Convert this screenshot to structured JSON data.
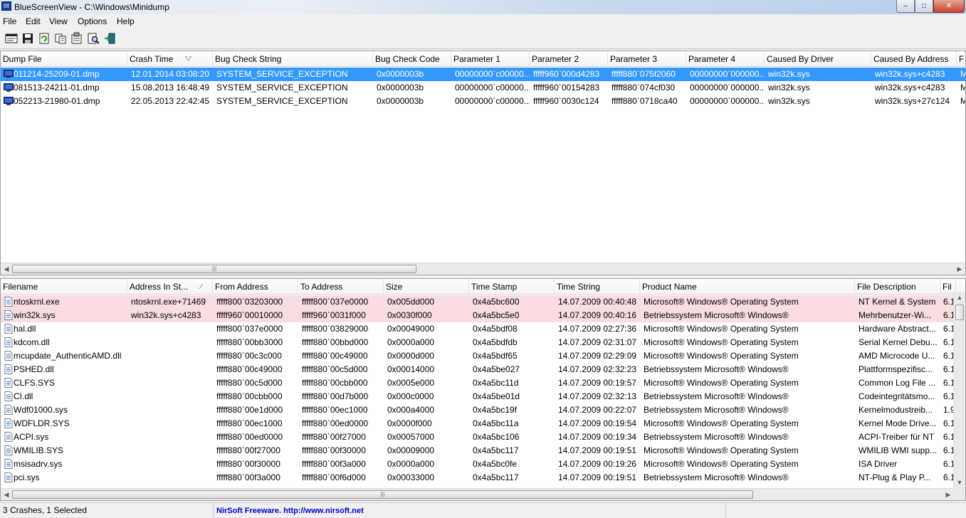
{
  "window": {
    "title": "BlueScreenView  -  C:\\Windows\\Minidump",
    "min_symbol": "–",
    "max_symbol": "□",
    "close_symbol": "✕"
  },
  "menu": [
    "File",
    "Edit",
    "View",
    "Options",
    "Help"
  ],
  "toolbar": [
    "html-report-icon",
    "save-icon",
    "refresh-icon",
    "copy-icon",
    "properties-icon",
    "find-icon",
    "exit-icon"
  ],
  "dumps": {
    "columns": [
      "Dump File",
      "Crash Time",
      "Bug Check String",
      "Bug Check Code",
      "Parameter 1",
      "Parameter 2",
      "Parameter 3",
      "Parameter 4",
      "Caused By Driver",
      "Caused By Address",
      "F"
    ],
    "rows": [
      [
        "011214-25209-01.dmp",
        "12.01.2014 03:08:20",
        "SYSTEM_SERVICE_EXCEPTION",
        "0x0000003b",
        "00000000`c00000...",
        "fffff960`000d4283",
        "fffff880`075f2060",
        "00000000`000000...",
        "win32k.sys",
        "win32k.sys+c4283",
        "M"
      ],
      [
        "081513-24211-01.dmp",
        "15.08.2013 16:48:49",
        "SYSTEM_SERVICE_EXCEPTION",
        "0x0000003b",
        "00000000`c00000...",
        "fffff960`00154283",
        "fffff880`074cf030",
        "00000000`000000...",
        "win32k.sys",
        "win32k.sys+c4283",
        "M"
      ],
      [
        "052213-21980-01.dmp",
        "22.05.2013 22:42:45",
        "SYSTEM_SERVICE_EXCEPTION",
        "0x0000003b",
        "00000000`c00000...",
        "fffff960`0030c124",
        "fffff880`0718ca40",
        "00000000`000000...",
        "win32k.sys",
        "win32k.sys+27c124",
        "M"
      ]
    ],
    "selected_index": 0
  },
  "drivers": {
    "columns": [
      "Filename",
      "Address In St...",
      "From Address",
      "To Address",
      "Size",
      "Time Stamp",
      "Time String",
      "Product Name",
      "File Description",
      "Fil"
    ],
    "rows": [
      [
        "ntoskrnl.exe",
        "ntoskrnl.exe+71469",
        "fffff800`03203000",
        "fffff800`037e0000",
        "0x005dd000",
        "0x4a5bc600",
        "14.07.2009 00:40:48",
        "Microsoft® Windows® Operating System",
        "NT Kernel & System",
        "6.1"
      ],
      [
        "win32k.sys",
        "win32k.sys+c4283",
        "fffff960`00010000",
        "fffff960`0031f000",
        "0x0030f000",
        "0x4a5bc5e0",
        "14.07.2009 00:40:16",
        "Betriebssystem Microsoft® Windows®",
        "Mehrbenutzer-Wi...",
        "6.1"
      ],
      [
        "hal.dll",
        "",
        "fffff800`037e0000",
        "fffff800`03829000",
        "0x00049000",
        "0x4a5bdf08",
        "14.07.2009 02:27:36",
        "Microsoft® Windows® Operating System",
        "Hardware Abstract...",
        "6.1"
      ],
      [
        "kdcom.dll",
        "",
        "fffff880`00bb3000",
        "fffff880`00bbd000",
        "0x0000a000",
        "0x4a5bdfdb",
        "14.07.2009 02:31:07",
        "Microsoft® Windows® Operating System",
        "Serial Kernel Debu...",
        "6.1"
      ],
      [
        "mcupdate_AuthenticAMD.dll",
        "",
        "fffff880`00c3c000",
        "fffff880`00c49000",
        "0x0000d000",
        "0x4a5bdf65",
        "14.07.2009 02:29:09",
        "Microsoft® Windows® Operating System",
        "AMD Microcode U...",
        "6.1"
      ],
      [
        "PSHED.dll",
        "",
        "fffff880`00c49000",
        "fffff880`00c5d000",
        "0x00014000",
        "0x4a5be027",
        "14.07.2009 02:32:23",
        "Betriebssystem Microsoft® Windows®",
        "Plattformspezifisc...",
        "6.1"
      ],
      [
        "CLFS.SYS",
        "",
        "fffff880`00c5d000",
        "fffff880`00cbb000",
        "0x0005e000",
        "0x4a5bc11d",
        "14.07.2009 00:19:57",
        "Microsoft® Windows® Operating System",
        "Common Log File ...",
        "6.1"
      ],
      [
        "CI.dll",
        "",
        "fffff880`00cbb000",
        "fffff880`00d7b000",
        "0x000c0000",
        "0x4a5be01d",
        "14.07.2009 02:32:13",
        "Betriebssystem Microsoft® Windows®",
        "Codeintegritätsmo...",
        "6.1"
      ],
      [
        "Wdf01000.sys",
        "",
        "fffff880`00e1d000",
        "fffff880`00ec1000",
        "0x000a4000",
        "0x4a5bc19f",
        "14.07.2009 00:22:07",
        "Betriebssystem Microsoft® Windows®",
        "Kernelmodustreib...",
        "1.9"
      ],
      [
        "WDFLDR.SYS",
        "",
        "fffff880`00ec1000",
        "fffff880`00ed0000",
        "0x0000f000",
        "0x4a5bc11a",
        "14.07.2009 00:19:54",
        "Microsoft® Windows® Operating System",
        "Kernel Mode Drive...",
        "6.1"
      ],
      [
        "ACPI.sys",
        "",
        "fffff880`00ed0000",
        "fffff880`00f27000",
        "0x00057000",
        "0x4a5bc106",
        "14.07.2009 00:19:34",
        "Betriebssystem Microsoft® Windows®",
        "ACPI-Treiber für NT",
        "6.1"
      ],
      [
        "WMILIB.SYS",
        "",
        "fffff880`00f27000",
        "fffff880`00f30000",
        "0x00009000",
        "0x4a5bc117",
        "14.07.2009 00:19:51",
        "Microsoft® Windows® Operating System",
        "WMILIB WMI supp...",
        "6.1"
      ],
      [
        "msisadrv.sys",
        "",
        "fffff880`00f30000",
        "fffff880`00f3a000",
        "0x0000a000",
        "0x4a5bc0fe",
        "14.07.2009 00:19:26",
        "Microsoft® Windows® Operating System",
        "ISA Driver",
        "6.1"
      ],
      [
        "pci.sys",
        "",
        "fffff880`00f3a000",
        "fffff880`00f6d000",
        "0x00033000",
        "0x4a5bc117",
        "14.07.2009 00:19:51",
        "Betriebssystem Microsoft® Windows®",
        "NT-Plug & Play P...",
        "6.1"
      ]
    ],
    "highlighted_count": 2
  },
  "status": {
    "summary": "3 Crashes, 1 Selected",
    "link": "NirSoft Freeware.  http://www.nirsoft.net"
  }
}
